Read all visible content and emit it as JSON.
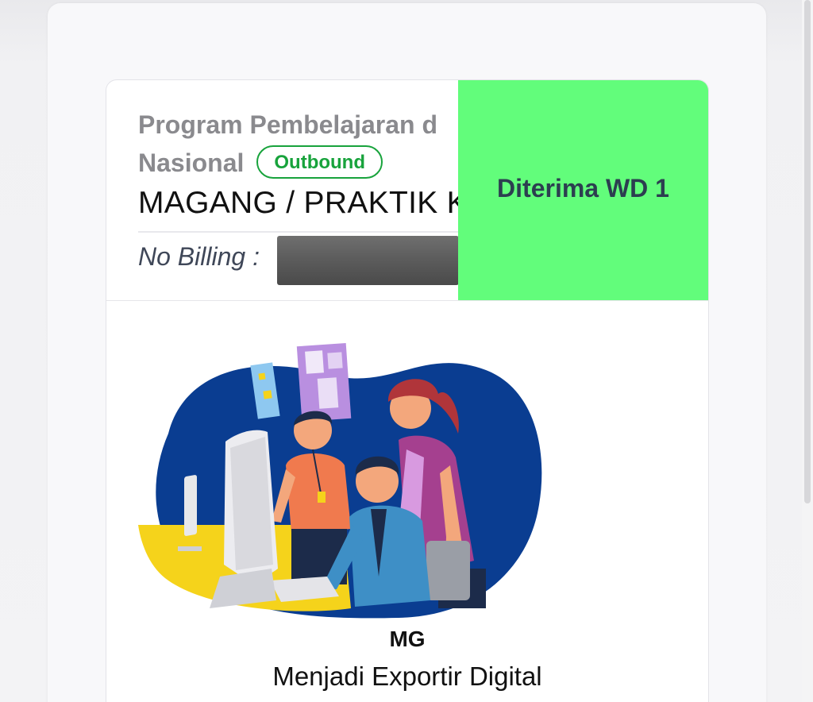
{
  "program": {
    "name": "Program Pembelajaran di Luar Kampus Nasional",
    "name_visible_line1": "Program Pembelajaran d",
    "name_visible_line2": "Nasional",
    "badge": "Outbound",
    "activity": "MAGANG / PRAKTIK K",
    "billing_label": "No Billing :",
    "status": "Diterima WD 1",
    "status_color": "#62fd7b",
    "badge_color": "#18a33c"
  },
  "product": {
    "code": "MG",
    "name": "Menjadi Exportir Digital"
  },
  "illustration": {
    "icon": "office-team-computer-illustration"
  }
}
